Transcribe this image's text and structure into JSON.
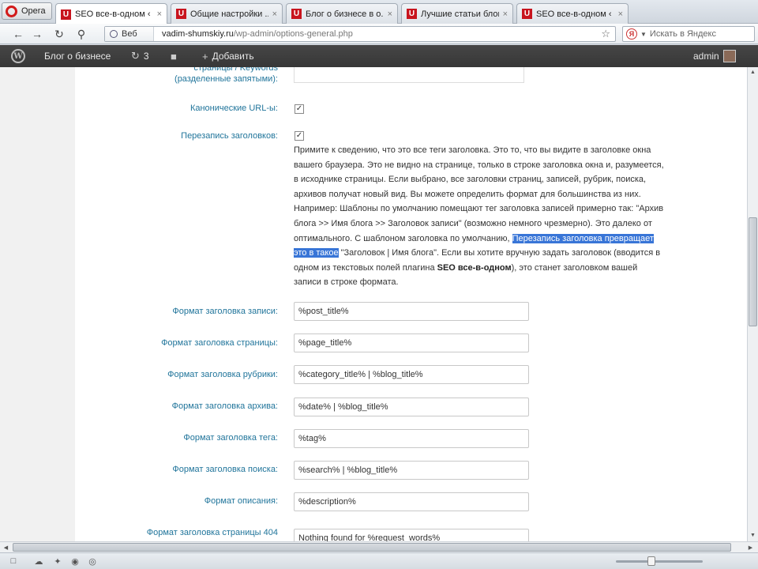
{
  "browser": {
    "menu_label": "Opera",
    "tabs": [
      {
        "title": "SEO все-в-одном ‹ ...",
        "active": true
      },
      {
        "title": "Общие настройки ...",
        "active": false
      },
      {
        "title": "Блог о бизнесе в о...",
        "active": false
      },
      {
        "title": "Лучшие статьи блог...",
        "active": false
      },
      {
        "title": "SEO все-в-одном ‹ ...",
        "active": false
      }
    ],
    "tab_close": "×",
    "tab_icon_letter": "U",
    "address": {
      "mode_label": "Веб",
      "domain": "vadim-shumskiy.ru",
      "path": "/wp-admin/options-general.php"
    },
    "search_placeholder": "Искать в Яндекс"
  },
  "adminbar": {
    "site_name": "Блог о бизнесе",
    "updates_count": "3",
    "add_new_label": "Добавить",
    "user_label": "admin"
  },
  "settings": {
    "keywords_label_line1": "страницы / Keywords",
    "keywords_label_line2": "(разделенные запятыми):",
    "canonical_label": "Канонические URL-ы:",
    "canonical_checked": true,
    "rewrite_label": "Перезапись заголовков:",
    "rewrite_checked": true,
    "checkmark": "✓",
    "description": {
      "part1": "Примите к сведению, что это все теги заголовка. Это то, что вы видите в заголовке окна вашего браузера. Это не видно на странице, только в строке заголовка окна и, разумеется, в исходнике страницы. Если выбрано, все заголовки страниц, записей, рубрик, поиска, архивов получат новый вид. Вы можете определить формат для большинства из них. Например: Шаблоны по умолчанию помещают тег заголовка записей примерно так: \"Архив блога >> Имя блога >> Заголовок записи\" (возможно немного чрезмерно). Это далеко от оптимального. С шаблоном заголовка по умолчанию, ",
      "highlight": "Перезапись заголовка превращает это в такое",
      "part2": " \"Заголовок | Имя блога\". Если вы хотите вручную задать заголовок (вводится в одном из текстовых полей плагина ",
      "bold": "SEO все-в-одном",
      "part3": "), это станет заголовком вашей записи в строке формата."
    },
    "fields": [
      {
        "label": "Формат заголовка записи:",
        "value": "%post_title%"
      },
      {
        "label": "Формат заголовка страницы:",
        "value": "%page_title%"
      },
      {
        "label": "Формат заголовка рубрики:",
        "value": "%category_title% | %blog_title%"
      },
      {
        "label": "Формат заголовка архива:",
        "value": "%date% | %blog_title%"
      },
      {
        "label": "Формат заголовка тега:",
        "value": "%tag%"
      },
      {
        "label": "Формат заголовка поиска:",
        "value": "%search% | %blog_title%"
      },
      {
        "label": "Формат описания:",
        "value": "%description%"
      },
      {
        "label": "Формат заголовка страницы 404",
        "value": "Nothing found for %request_words%"
      }
    ]
  },
  "colors": {
    "label_link": "#21759b",
    "selection": "#3875d7",
    "adminbar_bg": "#464646"
  }
}
